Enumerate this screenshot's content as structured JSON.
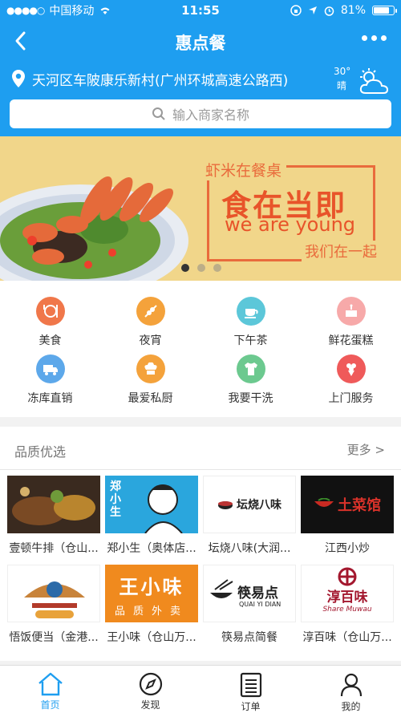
{
  "status_bar": {
    "carrier": "中国移动",
    "time": "11:55",
    "battery_text": "81%",
    "battery_level": 0.81
  },
  "nav": {
    "title": "惠点餐"
  },
  "location": {
    "address": "天河区车陂康乐新村(广州环城高速公路西)",
    "weather_temp": "30°",
    "weather_desc": "晴"
  },
  "search": {
    "placeholder": "输入商家名称"
  },
  "banner": {
    "tag": "虾米在餐桌",
    "headline": "食在当即",
    "english": "we are young",
    "sub": "我们在一起",
    "page_count": 3,
    "active_page": 1
  },
  "categories": [
    {
      "label": "美食",
      "icon": "food-icon",
      "color": "#f0774a"
    },
    {
      "label": "夜宵",
      "icon": "skewer-icon",
      "color": "#f4a23b"
    },
    {
      "label": "下午茶",
      "icon": "cup-icon",
      "color": "#5cc7d9"
    },
    {
      "label": "鲜花蛋糕",
      "icon": "cake-icon",
      "color": "#f7a9a9"
    },
    {
      "label": "冻库直销",
      "icon": "truck-icon",
      "color": "#5da8ea"
    },
    {
      "label": "最爱私厨",
      "icon": "chef-icon",
      "color": "#f4a23b"
    },
    {
      "label": "我要干洗",
      "icon": "shirt-icon",
      "color": "#6cc98f"
    },
    {
      "label": "上门服务",
      "icon": "bouquet-icon",
      "color": "#ef5a5a"
    }
  ],
  "quality": {
    "title": "品质优选",
    "more": "更多 >",
    "shops": [
      {
        "name": "壹顿牛排（仓山..."
      },
      {
        "name": "郑小生（奥体店..."
      },
      {
        "name": "坛烧八味(大润..."
      },
      {
        "name": "江西小炒"
      },
      {
        "name": "悟饭便当（金港..."
      },
      {
        "name": "王小味（仓山万..."
      },
      {
        "name": "筷易点简餐"
      },
      {
        "name": "淳百味（仓山万..."
      }
    ],
    "logo_text": {
      "zheng": "郑小生",
      "tanshao": "坛烧八味",
      "tucaiguan": "土菜馆",
      "wangxiaowei": "王小味",
      "wangxiaowei_sub": "品质外卖",
      "kuaiyidian": "筷易点",
      "kuaiyidian_en": "QUAI YI DIAN",
      "chunbaiwei": "淳百味",
      "chunbaiwei_en": "Share Muwau"
    }
  },
  "tabs": [
    {
      "label": "首页",
      "icon": "home-icon",
      "active": true
    },
    {
      "label": "发现",
      "icon": "compass-icon",
      "active": false
    },
    {
      "label": "订单",
      "icon": "order-list-icon",
      "active": false
    },
    {
      "label": "我的",
      "icon": "user-icon",
      "active": false
    }
  ],
  "colors": {
    "brand": "#1e9ef0",
    "banner_bg": "#f1d68a",
    "banner_accent": "#e8542a"
  }
}
